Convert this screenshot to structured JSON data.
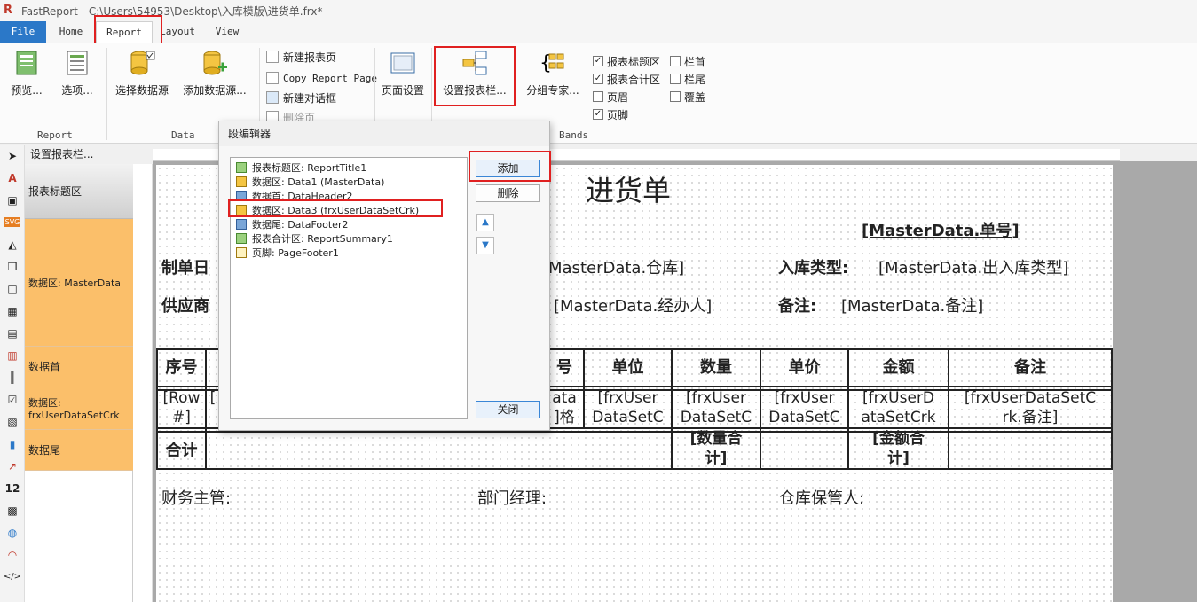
{
  "window": {
    "title": "FastReport - C:\\Users\\54953\\Desktop\\入库模版\\进货单.frx*"
  },
  "tabs": [
    "File",
    "Home",
    "Report",
    "Layout",
    "View"
  ],
  "ribbon": {
    "report_group": {
      "label": "Report",
      "preview": "预览...",
      "options": "选项..."
    },
    "data_group": {
      "label": "Data",
      "select_source": "选择数据源",
      "add_source": "添加数据源..."
    },
    "pages": {
      "new_page": "新建报表页",
      "copy_page": "Copy Report Page",
      "new_dialog": "新建对话框",
      "delete_page": "删除页"
    },
    "page_setup": "页面设置",
    "bands_setup": "设置报表栏...",
    "group_expert": "分组专家...",
    "bands_group": {
      "label": "Bands",
      "items": [
        {
          "label": "报表标题区",
          "checked": true
        },
        {
          "label": "报表合计区",
          "checked": true
        },
        {
          "label": "页眉",
          "checked": false
        },
        {
          "label": "页脚",
          "checked": true
        },
        {
          "label": "栏首",
          "checked": false
        },
        {
          "label": "栏尾",
          "checked": false
        },
        {
          "label": "覆盖",
          "checked": false
        }
      ]
    }
  },
  "band_panel": {
    "header": "设置报表栏...",
    "items": [
      "报表标题区",
      "数据区: MasterData",
      "数据首",
      "数据区:\nfrxUserDataSetCrk",
      "数据尾"
    ]
  },
  "report": {
    "title": "进货单",
    "order_no": "[MasterData.单号]",
    "maker_label": "制单日",
    "warehouse": "MasterData.仓库]",
    "stock_type_label": "入库类型:",
    "stock_type": "[MasterData.出入库类型]",
    "supplier_label": "供应商",
    "handler": "[MasterData.经办人]",
    "remark_label": "备注:",
    "remark": "[MasterData.备注]",
    "headers": [
      "序号",
      "号",
      "单位",
      "数量",
      "单价",
      "金额",
      "备注"
    ],
    "row_no": "[Row\n#]",
    "row_l": "[",
    "spec": "ata\n]格",
    "unit": "[frxUser\nDataSetC",
    "qty": "[frxUser\nDataSetC",
    "price": "[frxUser\nDataSetC",
    "amount": "[frxUserD\nataSetCrk",
    "note": "[frxUserDataSetC\nrk.备注]",
    "total_label": "合计",
    "qty_total": "[数量合\n计]",
    "amount_total": "[金额合\n计]",
    "finance": "财务主管:",
    "dept": "部门经理:",
    "keeper": "仓库保管人:"
  },
  "dialog": {
    "title": "段编辑器",
    "items": [
      "报表标题区: ReportTitle1",
      "数据区: Data1 (MasterData)",
      "数据首: DataHeader2",
      "数据区: Data3 (frxUserDataSetCrk)",
      "数据尾: DataFooter2",
      "报表合计区: ReportSummary1",
      "页脚: PageFooter1"
    ],
    "add": "添加",
    "delete": "删除",
    "close": "关闭"
  },
  "colors": {
    "accent": "#2b78c8",
    "band_orange": "#fbbf6a",
    "highlight": "#e02020"
  }
}
